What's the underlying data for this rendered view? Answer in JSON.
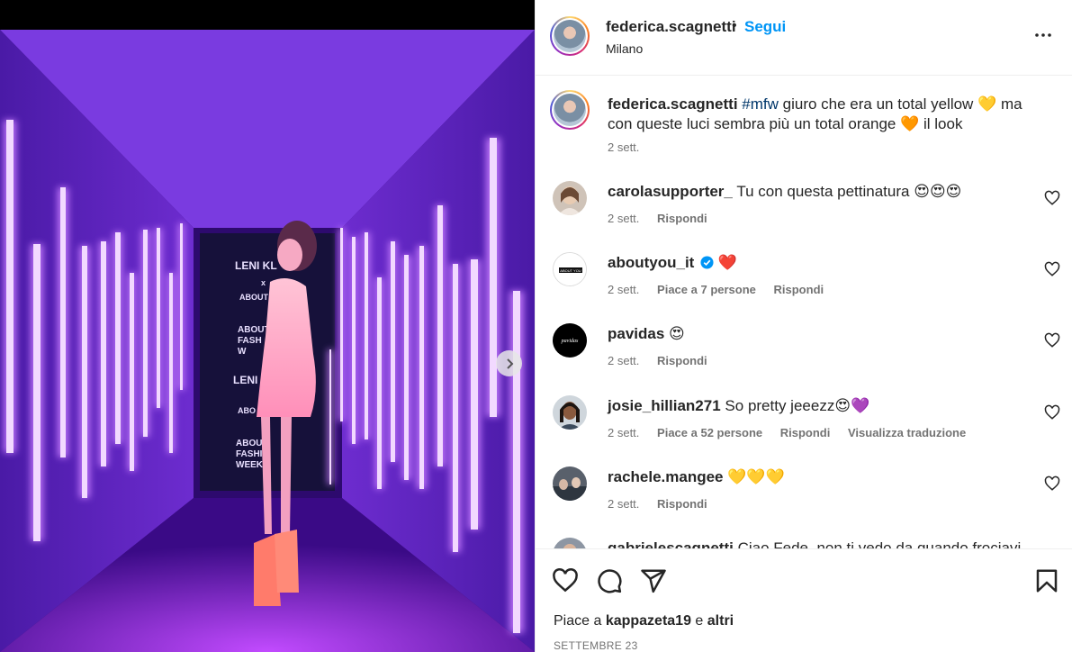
{
  "post": {
    "author": "federica.scagnetti",
    "dot": "•",
    "follow_label": "Segui",
    "location": "Milano"
  },
  "caption": {
    "username": "federica.scagnetti",
    "hashtag": "#mfw",
    "text_part1": " giuro che era un total yellow ",
    "emoji1": "💛",
    "text_part2": " ma con queste luci sembra più un total orange ",
    "emoji2": "🧡",
    "text_part3": " il look",
    "time": "2 sett."
  },
  "comments": [
    {
      "username": "carolasupporter_",
      "text": "Tu con questa pettinatura",
      "emoji": "😍😍😍",
      "time": "2 sett.",
      "likes": "",
      "reply": "Rispondi",
      "translate": ""
    },
    {
      "username": "aboutyou_it",
      "verified": true,
      "text": "",
      "emoji": "❤️",
      "time": "2 sett.",
      "likes": "Piace a 7 persone",
      "reply": "Rispondi",
      "translate": ""
    },
    {
      "username": "pavidas",
      "text": "",
      "emoji": "😍",
      "time": "2 sett.",
      "likes": "",
      "reply": "Rispondi",
      "translate": ""
    },
    {
      "username": "josie_hillian271",
      "text": "So pretty jeeezz",
      "emoji": "😍💜",
      "time": "2 sett.",
      "likes": "Piace a 52 persone",
      "reply": "Rispondi",
      "translate": "Visualizza traduzione"
    },
    {
      "username": "rachele.mangee",
      "text": "",
      "emoji": "💛💛💛",
      "time": "2 sett.",
      "likes": "",
      "reply": "Rispondi",
      "translate": ""
    },
    {
      "username": "gabrielescagnetti",
      "text": "Ciao Fede, non ti vedo da quando frociavi",
      "emoji": "",
      "time": "",
      "likes": "",
      "reply": "",
      "translate": ""
    }
  ],
  "avatar_labels": {
    "aboutyou": "ABOUT YOU",
    "pavidas": "pavidas"
  },
  "photo_sign": {
    "line1": "LENI KL",
    "line2": "x",
    "line3": "ABOUT Y",
    "line4": "ABOUT",
    "line5": "FASH",
    "line6": "W",
    "line7": "LENI",
    "line8": "ABO",
    "line9": "ABOU",
    "line10": "FASHI",
    "line11": "WEEK"
  },
  "footer": {
    "likes_prefix": "Piace a ",
    "likes_user": "kappazeta19",
    "likes_mid": " e ",
    "likes_others": "altri",
    "date": "SETTEMBRE 23"
  },
  "icons": [
    "more-icon",
    "heart-icon",
    "comment-icon",
    "share-icon",
    "bookmark-icon",
    "chevron-right-icon",
    "verified-icon"
  ],
  "colors": {
    "link_blue": "#0095f6",
    "hashtag": "#00376b",
    "secondary_text": "#737373",
    "neon": "#d9a8ff",
    "room": "#5a1fbf"
  }
}
